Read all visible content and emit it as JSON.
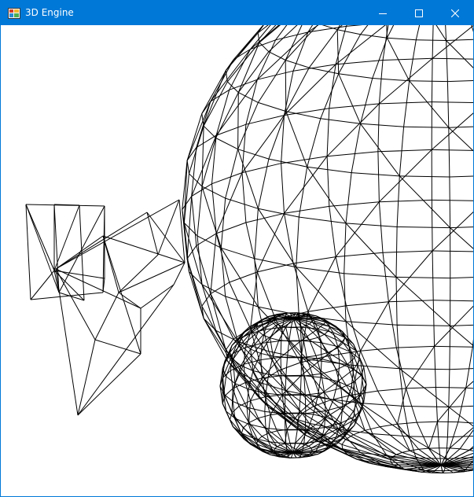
{
  "window": {
    "title": "3D Engine",
    "title_color": "#0078d7",
    "title_text_color": "#ffffff"
  },
  "caption_buttons": {
    "minimize": "minimize-icon",
    "maximize": "maximize-icon",
    "close": "close-icon"
  },
  "scene": {
    "background": "#ffffff",
    "line_color": "#000000",
    "objects": [
      "wireframe-cube",
      "wireframe-triangular-solid",
      "large-wireframe-sphere",
      "small-wireframe-sphere"
    ]
  }
}
